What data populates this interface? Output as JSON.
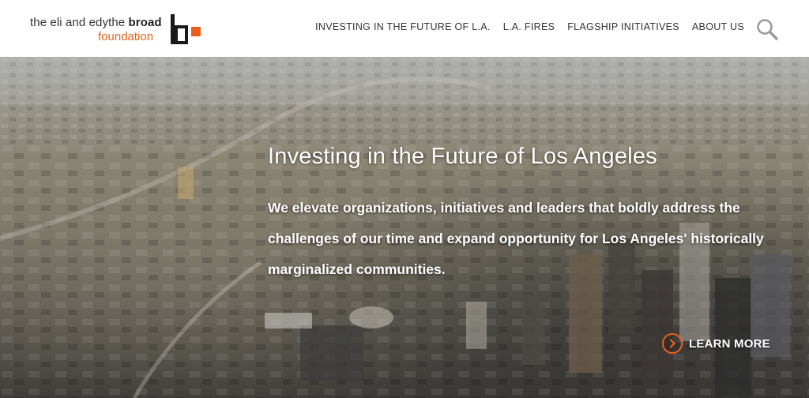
{
  "header": {
    "logo": {
      "line1_prefix": "the eli and edythe ",
      "line1_bold": "broad",
      "line2": "foundation",
      "brand_color": "#e8601c"
    },
    "nav": [
      {
        "label": "INVESTING IN THE FUTURE OF L.A."
      },
      {
        "label": "L.A. FIRES"
      },
      {
        "label": "FLAGSHIP INITIATIVES"
      },
      {
        "label": "ABOUT US"
      }
    ],
    "search_icon": "search-icon"
  },
  "hero": {
    "title": "Investing in the Future of Los Angeles",
    "description": "We elevate organizations, initiatives and leaders that boldly address the challenges of our time and expand opportunity for Los Angeles' historically marginalized communities.",
    "cta_label": "LEARN MORE",
    "cta_icon": "chevron-right-circle-icon",
    "accent_color": "#e8601c"
  }
}
